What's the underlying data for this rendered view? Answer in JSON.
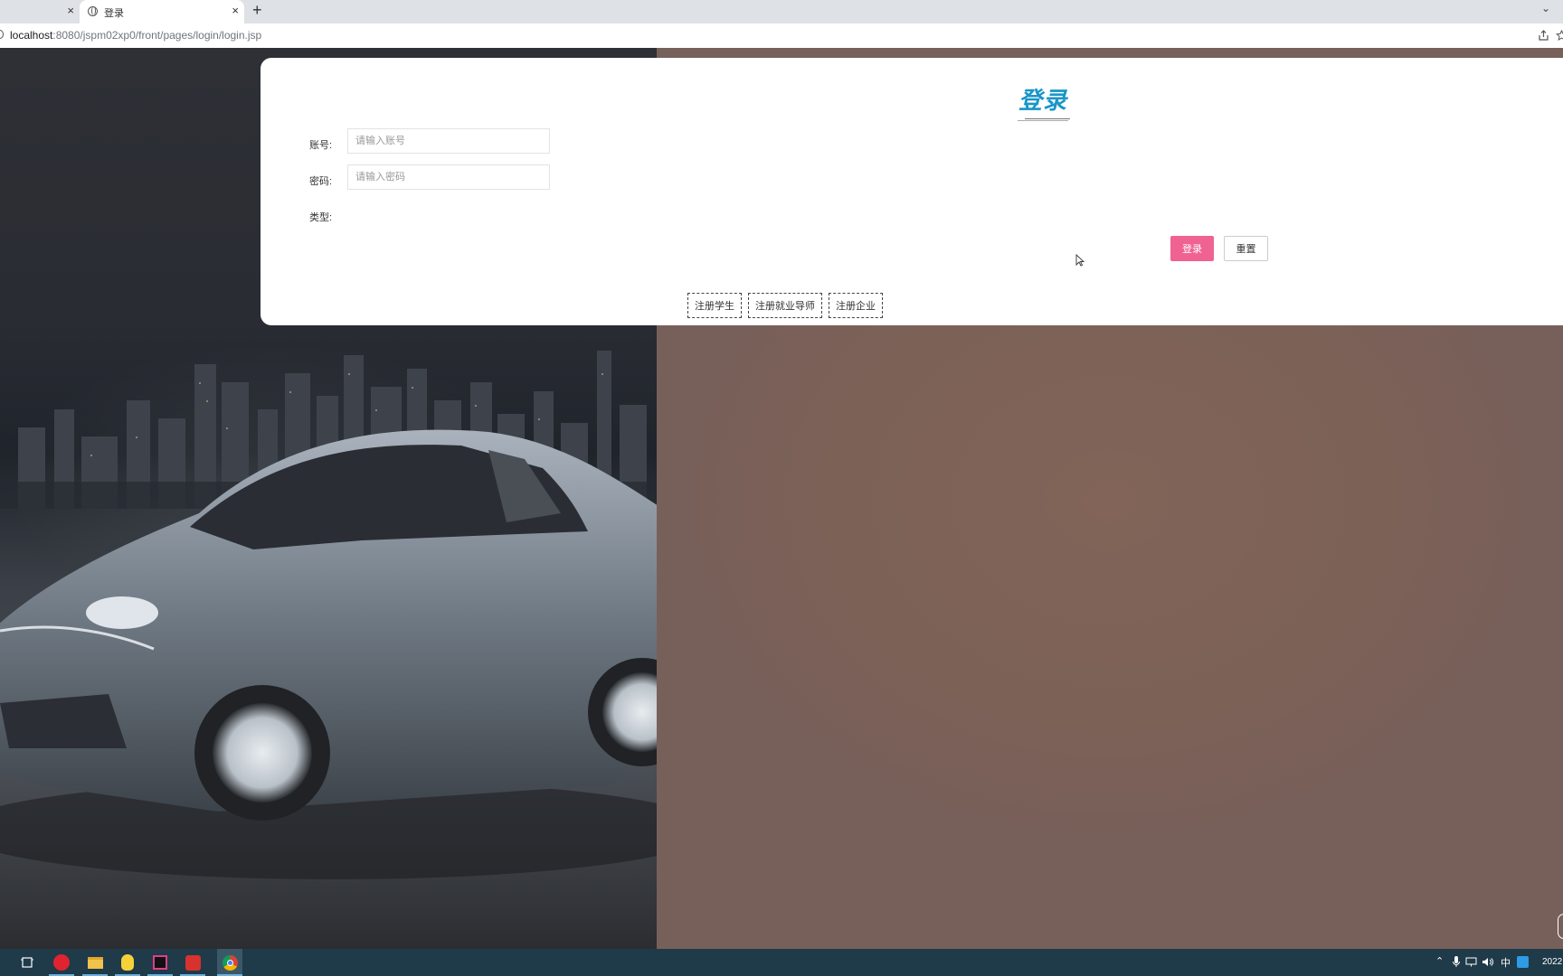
{
  "browser": {
    "active_tab_title": "登录",
    "url_host": "localhost",
    "url_path": ":8080/jspm02xp0/front/pages/login/login.jsp",
    "close_glyph": "×",
    "new_tab_glyph": "+",
    "tab_list_glyph": "⌄"
  },
  "login": {
    "title": "登录",
    "account_label": "账号:",
    "account_placeholder": "请输入账号",
    "password_label": "密码:",
    "password_placeholder": "请输入密码",
    "type_label": "类型:",
    "login_button": "登录",
    "reset_button": "重置",
    "register_buttons": [
      "注册学生",
      "注册就业导师",
      "注册企业"
    ]
  },
  "taskbar": {
    "tray_ime": "中",
    "clock_partial": "2022",
    "icons": [
      "task-view-icon",
      "netease-music-icon",
      "file-explorer-icon",
      "qq-icon",
      "intellij-idea-icon",
      "wps-office-icon",
      "chrome-icon"
    ]
  },
  "colors": {
    "title_blue": "#1996c8",
    "login_button_pink": "#f06292",
    "right_background": "#7e6358",
    "taskbar": "#1f3a48"
  }
}
